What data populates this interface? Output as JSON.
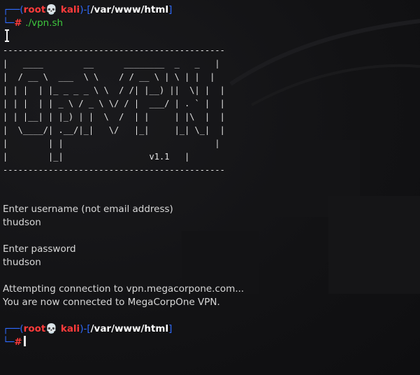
{
  "prompt1": {
    "corner_top": "┌──(",
    "user": "root",
    "skull": "💀",
    "host": " kali",
    "close": ")-[",
    "path": "/var/www/html",
    "end": "]",
    "corner_bottom": "└─",
    "hash": "# ",
    "command": "./vpn.sh"
  },
  "banner": [
    "--------------------------------------------",
    "|   ____        __      ________  _   _   |",
    "|  / __ \\  ___  \\ \\    / / __ \\ | \\ | |  |",
    "| | |  | |_ _ _ _ \\ \\  / /| |__) ||  \\| |  |",
    "| | |  | | _ \\ / _ \\ \\/ / |  ___/ | . ` |  |",
    "| | |__| | |_) | |  \\  /  | |     | |\\  |  |",
    "|  \\____/| .__/|_|   \\/   |_|     |_| \\_|  |",
    "|        | |                              |",
    "|        |_|                 v1.1   |",
    "--------------------------------------------"
  ],
  "output": {
    "username_prompt": "Enter username (not email address)",
    "username_value": "thudson",
    "password_prompt": "Enter password",
    "password_value": "thudson",
    "attempting": "Attempting connection to vpn.megacorpone.com...",
    "connected": "You are now connected to MegaCorpOne VPN."
  },
  "prompt2": {
    "corner_top": "┌──(",
    "user": "root",
    "skull": "💀",
    "host": " kali",
    "close": ")-[",
    "path": "/var/www/html",
    "end": "]",
    "corner_bottom": "└─",
    "hash": "#"
  },
  "colors": {
    "prompt_frame": "#2f6bff",
    "user": "#ff3b3b",
    "path": "#ffffff",
    "command": "#3ec83e",
    "background": "#111113"
  }
}
